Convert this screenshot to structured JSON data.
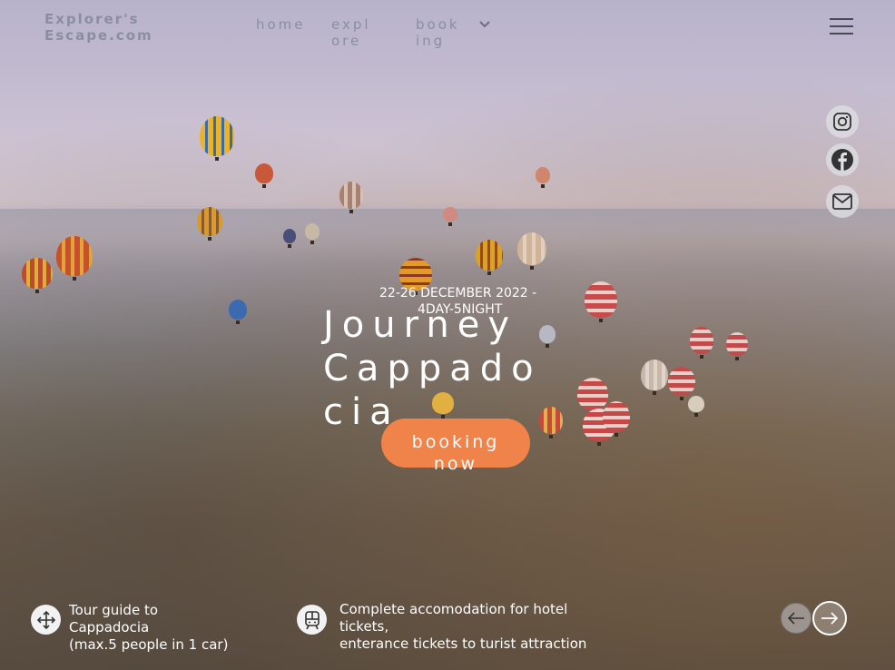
{
  "header": {
    "logo_line1": "Explorer's",
    "logo_line2": "Escape.com",
    "nav": [
      {
        "line1": "home",
        "line2": ""
      },
      {
        "line1": "expl",
        "line2": "ore"
      },
      {
        "line1": "book",
        "line2": "ing"
      }
    ]
  },
  "hero": {
    "dates_line1": "22-26 DECEMBER 2022  -",
    "dates_line2": "4DAY-5NIGHT",
    "title_line1": "Journey",
    "title_line2": "Cappado",
    "title_line3": "cia",
    "cta_line1": "booking",
    "cta_line2": "now"
  },
  "features": [
    {
      "icon": "move-icon",
      "line1": "Tour guide to",
      "line2": "Cappadocia",
      "line3": "(max.5 people in 1 car)"
    },
    {
      "icon": "train-icon",
      "line1": "Complete accomodation for hotel",
      "line2": "tickets,",
      "line3": "enterance tickets to turist attraction"
    }
  ],
  "social": [
    "instagram-icon",
    "facebook-icon",
    "mail-icon"
  ],
  "colors": {
    "accent": "#f0834a",
    "nav": "#8a8ea0"
  }
}
